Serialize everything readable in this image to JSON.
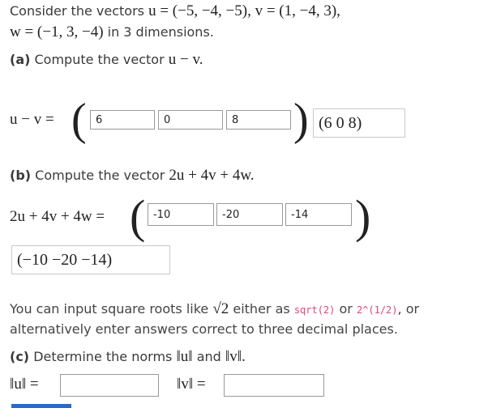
{
  "intro": {
    "line1_text": "Consider the vectors ",
    "line1_math": "u = (−5, −4, −5), v = (1, −4, 3),",
    "line2_math": "w = (−1, 3, −4)",
    "line2_text": " in 3 dimensions."
  },
  "part_a": {
    "label": "(a)",
    "prompt": " Compute the vector ",
    "prompt_math": "u − v.",
    "lhs": "u − v =",
    "inputs": [
      "6",
      "0",
      "8"
    ],
    "preview": "(6  0  8)"
  },
  "part_b": {
    "label": "(b)",
    "prompt": " Compute the vector ",
    "prompt_math": "2u + 4v + 4w.",
    "lhs": "2u + 4v + 4w =",
    "inputs": [
      "-10",
      "-20",
      "-14"
    ],
    "preview": "(−10   −20   −14)"
  },
  "hint": {
    "line1_a": "You can input square roots like ",
    "sqrt_math": "√2",
    "line1_b": " either as ",
    "code1": "sqrt(2)",
    "line1_c": " or ",
    "code2": "2^(1/2)",
    "line1_d": ", or",
    "line2": "alternatively enter answers correct to three decimal places."
  },
  "part_c": {
    "label": "(c)",
    "prompt": " Determine the norms ",
    "norm_u": "‖u‖",
    "and": " and ",
    "norm_v": "‖v‖.",
    "lhs_u": "‖u‖ =",
    "lhs_v": "‖v‖ =",
    "input_u": "",
    "input_v": ""
  }
}
